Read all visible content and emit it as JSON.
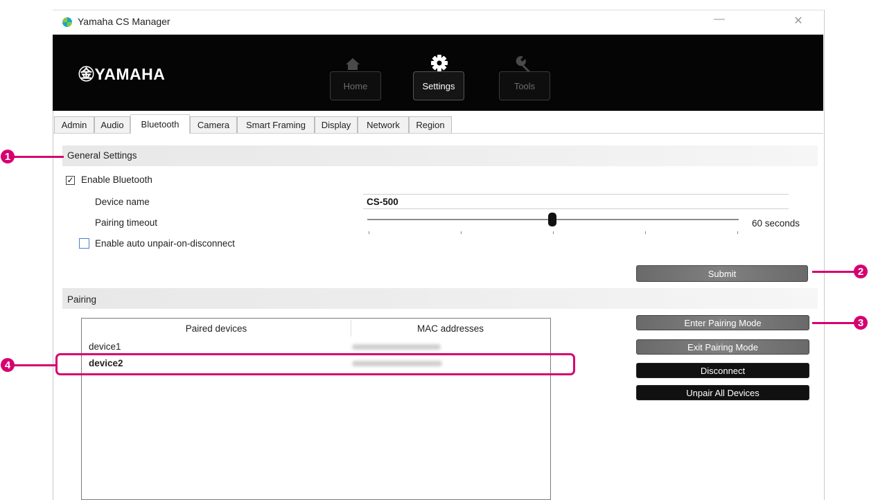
{
  "window": {
    "title": "Yamaha CS Manager",
    "minimize_glyph": "—",
    "close_glyph": "✕"
  },
  "header": {
    "logo": "㊎YAMAHA",
    "nav": [
      {
        "label": "Home",
        "icon": "home-icon",
        "active": false
      },
      {
        "label": "Settings",
        "icon": "gear-icon",
        "active": true
      },
      {
        "label": "Tools",
        "icon": "wrench-icon",
        "active": false
      }
    ]
  },
  "tabs": [
    "Admin",
    "Audio",
    "Bluetooth",
    "Camera",
    "Smart Framing",
    "Display",
    "Network",
    "Region"
  ],
  "active_tab": "Bluetooth",
  "general": {
    "section_title": "General Settings",
    "enable_bluetooth": {
      "label": "Enable Bluetooth",
      "checked": true
    },
    "device_name": {
      "label": "Device name",
      "value": "CS-500"
    },
    "pairing_timeout": {
      "label": "Pairing timeout",
      "value_text": "60 seconds",
      "fraction": 0.49
    },
    "auto_unpair": {
      "label": "Enable auto unpair-on-disconnect",
      "checked": false
    },
    "submit_label": "Submit"
  },
  "pairing": {
    "section_title": "Pairing",
    "columns": [
      "Paired devices",
      "MAC addresses"
    ],
    "rows": [
      {
        "device": "device1",
        "selected": false
      },
      {
        "device": "device2",
        "selected": true
      }
    ],
    "buttons": {
      "enter": "Enter Pairing Mode",
      "exit": "Exit Pairing Mode",
      "disconnect": "Disconnect",
      "unpair_all": "Unpair All Devices"
    }
  },
  "callouts": [
    "1",
    "2",
    "3",
    "4"
  ],
  "colors": {
    "accent": "#d6006f",
    "header_bg": "#050505",
    "button_gray": "#747474",
    "button_black": "#111111"
  }
}
